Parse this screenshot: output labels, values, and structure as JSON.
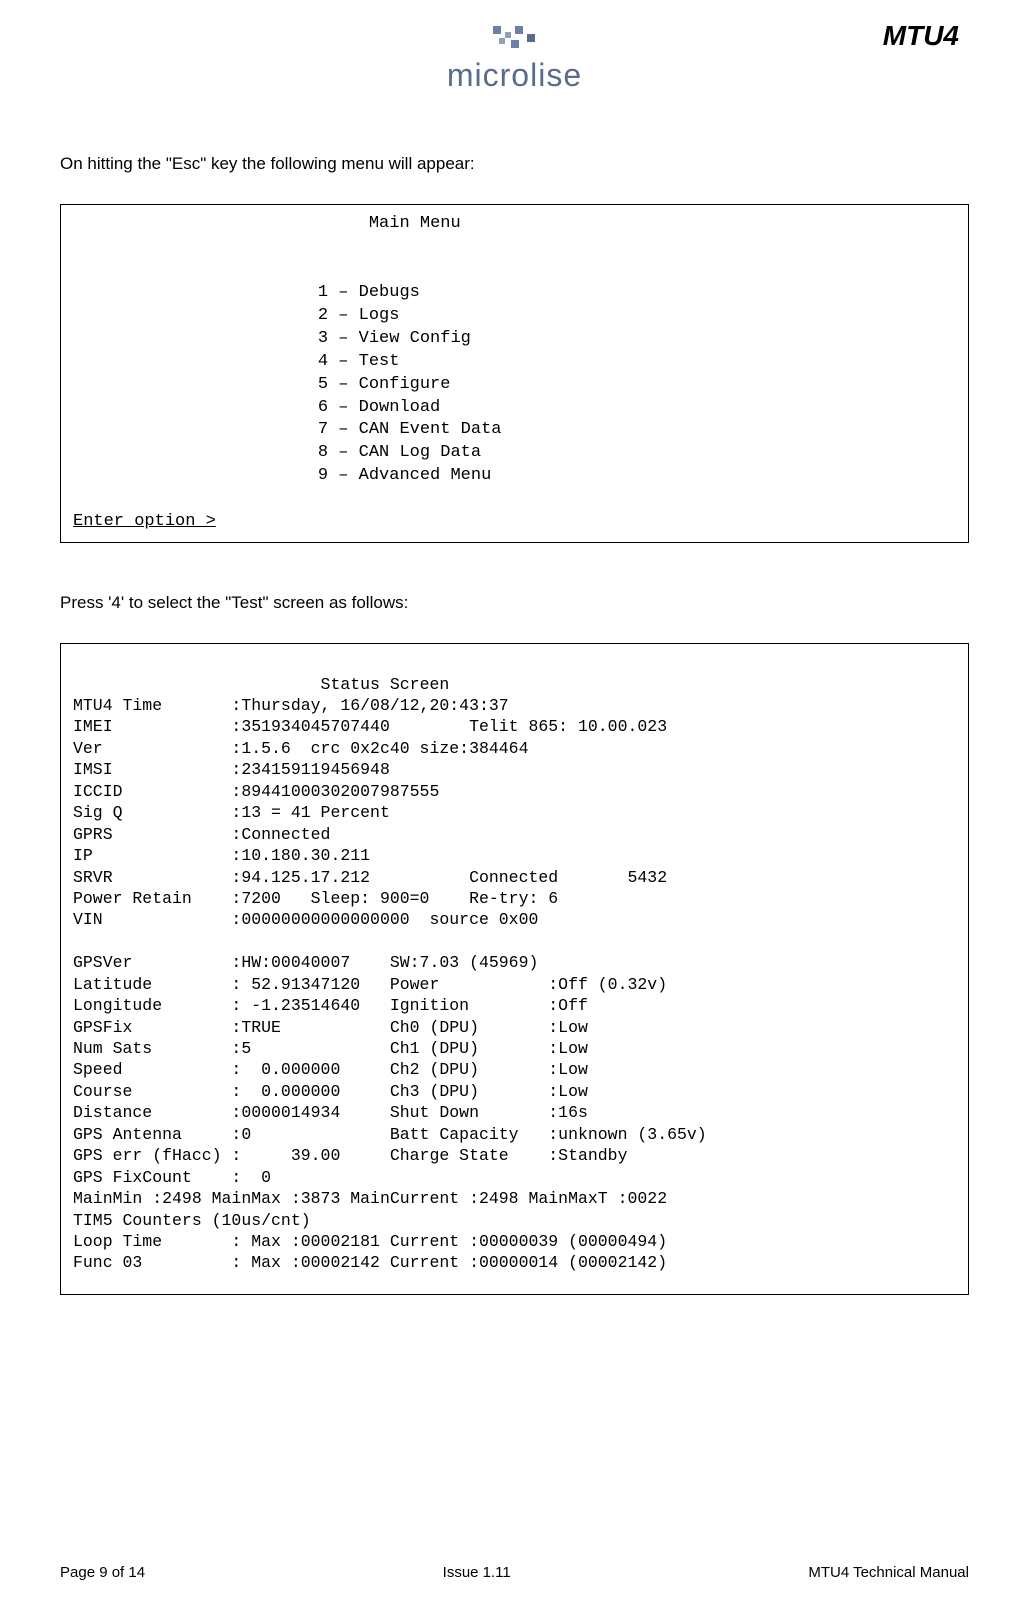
{
  "header": {
    "product": "MTU4",
    "brand": "microlise"
  },
  "intro1": "On hitting the \"Esc\" key the following menu will appear:",
  "menu": {
    "title": "Main Menu",
    "items": [
      "1 – Debugs",
      "2 – Logs",
      "3 – View Config",
      "4 – Test",
      "5 – Configure",
      "6 – Download",
      "7 – CAN Event Data",
      "8 – CAN Log Data",
      "9 – Advanced Menu"
    ],
    "prompt": "Enter option >"
  },
  "intro2": "Press '4' to select the \"Test\" screen as follows:",
  "status": {
    "title": "Status Screen",
    "lines": [
      "MTU4 Time       :Thursday, 16/08/12,20:43:37",
      "IMEI            :351934045707440        Telit 865: 10.00.023",
      "Ver             :1.5.6  crc 0x2c40 size:384464",
      "IMSI            :234159119456948",
      "ICCID           :89441000302007987555",
      "Sig Q           :13 = 41 Percent",
      "GPRS            :Connected",
      "IP              :10.180.30.211",
      "SRVR            :94.125.17.212          Connected       5432",
      "Power Retain    :7200   Sleep: 900=0    Re-try: 6",
      "VIN             :00000000000000000  source 0x00",
      "",
      "GPSVer          :HW:00040007    SW:7.03 (45969)",
      "Latitude        : 52.91347120   Power           :Off (0.32v)",
      "Longitude       : -1.23514640   Ignition        :Off",
      "GPSFix          :TRUE           Ch0 (DPU)       :Low",
      "Num Sats        :5              Ch1 (DPU)       :Low",
      "Speed           :  0.000000     Ch2 (DPU)       :Low",
      "Course          :  0.000000     Ch3 (DPU)       :Low",
      "Distance        :0000014934     Shut Down       :16s",
      "GPS Antenna     :0              Batt Capacity   :unknown (3.65v)",
      "GPS err (fHacc) :     39.00     Charge State    :Standby",
      "GPS FixCount    :  0",
      "MainMin :2498 MainMax :3873 MainCurrent :2498 MainMaxT :0022",
      "TIM5 Counters (10us/cnt)",
      "Loop Time       : Max :00002181 Current :00000039 (00000494)",
      "Func 03         : Max :00002142 Current :00000014 (00002142)"
    ]
  },
  "footer": {
    "left": "Page 9 of 14",
    "center": "Issue 1.11",
    "right": "MTU4 Technical Manual"
  }
}
